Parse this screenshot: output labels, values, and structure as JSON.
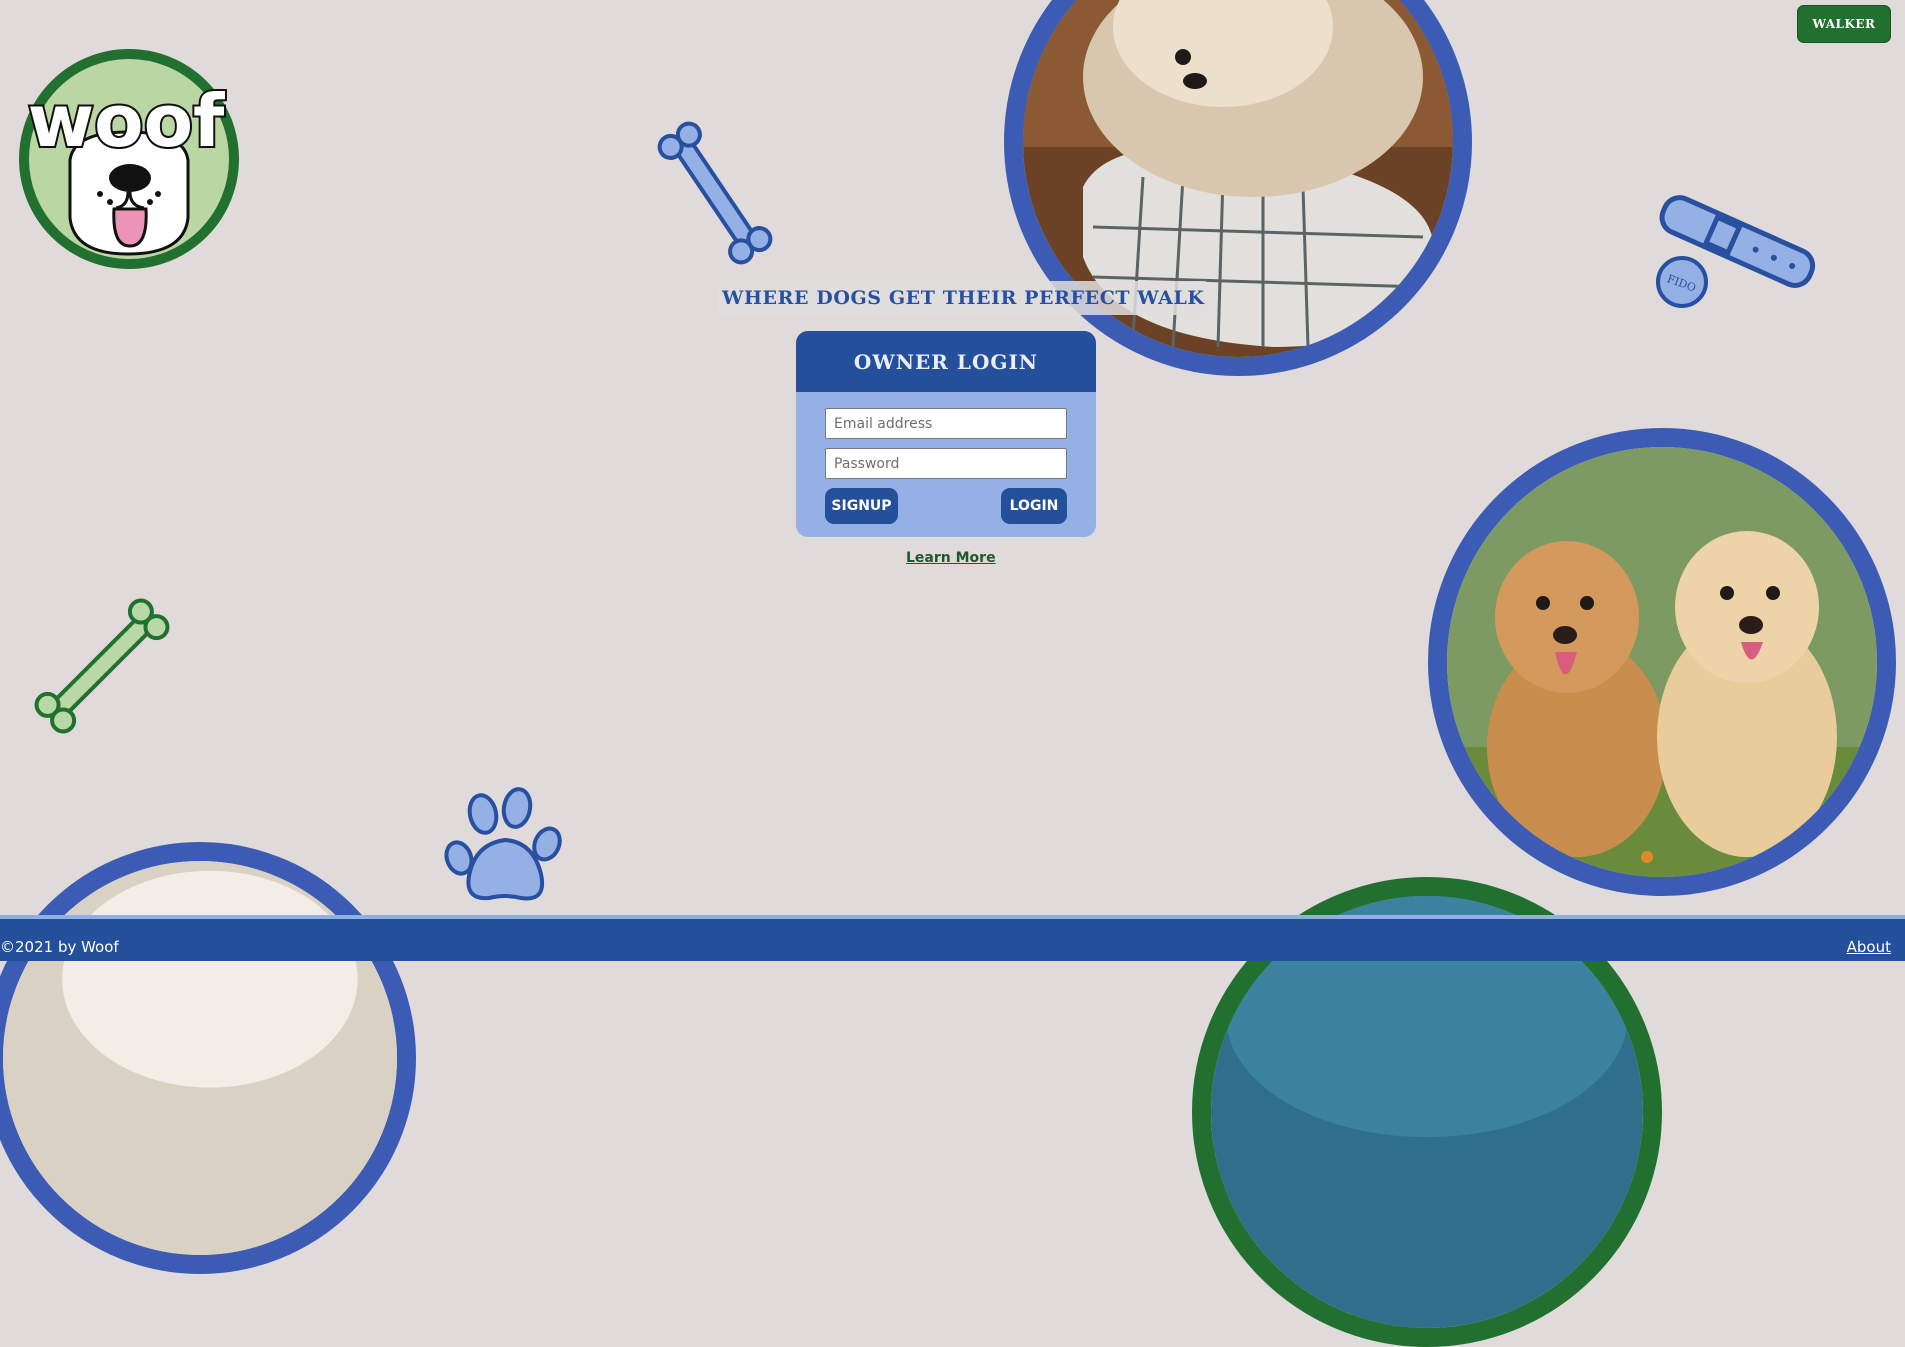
{
  "app": {
    "logo_text": "woof"
  },
  "header": {
    "walker_button_label": "WALKER"
  },
  "hero": {
    "tagline": "WHERE DOGS GET THEIR PERFECT WALK"
  },
  "login": {
    "title": "OWNER LOGIN",
    "email_placeholder": "Email address",
    "password_placeholder": "Password",
    "signup_label": "SIGNUP",
    "login_label": "LOGIN"
  },
  "links": {
    "learn_more": "Learn More"
  },
  "decor": {
    "collar_tag_text": "FIDO",
    "icons": [
      "bone-icon",
      "collar-icon",
      "paw-print-icon"
    ]
  },
  "footer": {
    "copyright": "©2021 by Woof",
    "about_label": "About"
  },
  "colors": {
    "background": "#e0dada",
    "primary_blue": "#244f9b",
    "light_blue": "#94b0e5",
    "photo_ring_blue": "#3b5bb5",
    "brand_green": "#22702f",
    "light_green": "#b8d8a6"
  }
}
